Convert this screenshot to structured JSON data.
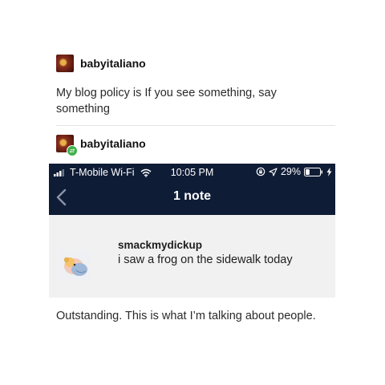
{
  "post1": {
    "username": "babyitaliano",
    "text": "My blog policy is If you see something, say something"
  },
  "post2": {
    "username": "babyitaliano",
    "caption": "Outstanding. This is what I’m talking about people."
  },
  "phone": {
    "carrier": "T-Mobile Wi-Fi",
    "time": "10:05 PM",
    "battery": "29%",
    "battery_level": 0.29,
    "nav_title": "1 note",
    "note": {
      "username": "smackmydickup",
      "text": "i saw a frog on the sidewalk today"
    }
  },
  "colors": {
    "nav_bg": "#0f1c36",
    "reblog_badge": "#3fb24a",
    "note_bg": "#f1f1f1"
  }
}
